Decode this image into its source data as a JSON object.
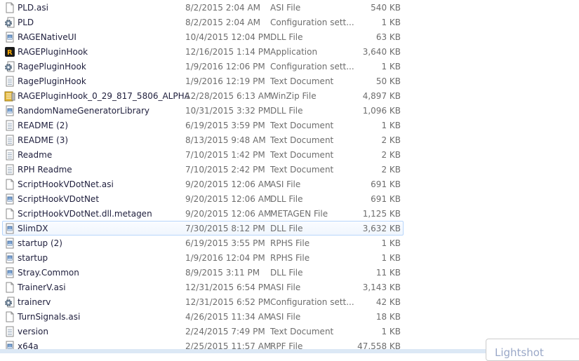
{
  "files": [
    {
      "name": "PLD.asi",
      "date": "8/2/2015 2:04 AM",
      "type": "ASI File",
      "size": "540 KB",
      "icon": "file"
    },
    {
      "name": "PLD",
      "date": "8/2/2015 2:04 AM",
      "type": "Configuration sett...",
      "size": "1 KB",
      "icon": "config"
    },
    {
      "name": "RAGENativeUI",
      "date": "10/4/2015 12:04 PM",
      "type": "DLL File",
      "size": "63 KB",
      "icon": "dll"
    },
    {
      "name": "RAGEPluginHook",
      "date": "12/16/2015 1:14 PM",
      "type": "Application",
      "size": "3,640 KB",
      "icon": "app"
    },
    {
      "name": "RagePluginHook",
      "date": "1/9/2016 12:06 PM",
      "type": "Configuration sett...",
      "size": "1 KB",
      "icon": "config"
    },
    {
      "name": "RagePluginHook",
      "date": "1/9/2016 12:19 PM",
      "type": "Text Document",
      "size": "50 KB",
      "icon": "text"
    },
    {
      "name": "RAGEPluginHook_0_29_817_5806_ALPHA",
      "date": "12/28/2015 6:13 AM",
      "type": "WinZip File",
      "size": "4,897 KB",
      "icon": "zip"
    },
    {
      "name": "RandomNameGeneratorLibrary",
      "date": "10/31/2015 3:32 PM",
      "type": "DLL File",
      "size": "1,096 KB",
      "icon": "dll"
    },
    {
      "name": "README (2)",
      "date": "6/19/2015 3:59 PM",
      "type": "Text Document",
      "size": "1 KB",
      "icon": "text"
    },
    {
      "name": "README (3)",
      "date": "8/13/2015 9:48 AM",
      "type": "Text Document",
      "size": "2 KB",
      "icon": "text"
    },
    {
      "name": "Readme",
      "date": "7/10/2015 1:42 PM",
      "type": "Text Document",
      "size": "2 KB",
      "icon": "text"
    },
    {
      "name": "RPH Readme",
      "date": "7/10/2015 2:42 PM",
      "type": "Text Document",
      "size": "2 KB",
      "icon": "text"
    },
    {
      "name": "ScriptHookVDotNet.asi",
      "date": "9/20/2015 12:06 AM",
      "type": "ASI File",
      "size": "691 KB",
      "icon": "file"
    },
    {
      "name": "ScriptHookVDotNet",
      "date": "9/20/2015 12:06 AM",
      "type": "DLL File",
      "size": "691 KB",
      "icon": "dll"
    },
    {
      "name": "ScriptHookVDotNet.dll.metagen",
      "date": "9/20/2015 12:06 AM",
      "type": "METAGEN File",
      "size": "1,125 KB",
      "icon": "file"
    },
    {
      "name": "SlimDX",
      "date": "7/30/2015 8:12 PM",
      "type": "DLL File",
      "size": "3,632 KB",
      "icon": "dll",
      "selected": true
    },
    {
      "name": "startup (2)",
      "date": "6/19/2015 3:55 PM",
      "type": "RPHS File",
      "size": "1 KB",
      "icon": "dll"
    },
    {
      "name": "startup",
      "date": "1/9/2016 12:04 PM",
      "type": "RPHS File",
      "size": "1 KB",
      "icon": "dll"
    },
    {
      "name": "Stray.Common",
      "date": "8/9/2015 3:11 PM",
      "type": "DLL File",
      "size": "11 KB",
      "icon": "dll"
    },
    {
      "name": "TrainerV.asi",
      "date": "12/31/2015 6:54 PM",
      "type": "ASI File",
      "size": "3,143 KB",
      "icon": "file"
    },
    {
      "name": "trainerv",
      "date": "12/31/2015 6:52 PM",
      "type": "Configuration sett...",
      "size": "42 KB",
      "icon": "config"
    },
    {
      "name": "TurnSignals.asi",
      "date": "4/26/2015 11:34 AM",
      "type": "ASI File",
      "size": "18 KB",
      "icon": "file"
    },
    {
      "name": "version",
      "date": "2/24/2015 7:49 PM",
      "type": "Text Document",
      "size": "1 KB",
      "icon": "text"
    },
    {
      "name": "x64a",
      "date": "2/25/2015 11:57 AM",
      "type": "RPF File",
      "size": "47,558 KB",
      "icon": "dll"
    }
  ],
  "popup": {
    "title": "Lightshot"
  }
}
